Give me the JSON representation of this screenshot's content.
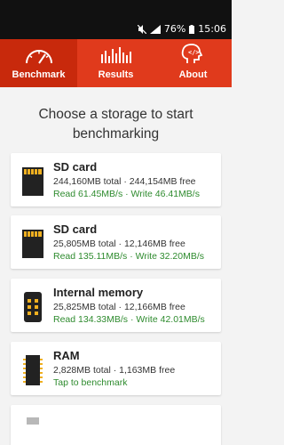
{
  "status": {
    "battery": "76%",
    "time": "15:06"
  },
  "tabs": [
    {
      "label": "Benchmark",
      "icon": "speedometer-icon"
    },
    {
      "label": "Results",
      "icon": "bar-graph-icon"
    },
    {
      "label": "About",
      "icon": "head-code-icon"
    }
  ],
  "heading": "Choose a storage to start benchmarking",
  "storages": [
    {
      "title": "SD card",
      "info": "244,160MB total · 244,154MB free",
      "speed": "Read 61.45MB/s · Write 46.41MB/s",
      "icon": "sd-card-icon"
    },
    {
      "title": "SD card",
      "info": "25,805MB total · 12,146MB free",
      "speed": "Read 135.11MB/s · Write 32.20MB/s",
      "icon": "sd-card-icon"
    },
    {
      "title": "Internal memory",
      "info": "25,825MB total · 12,166MB free",
      "speed": "Read 134.33MB/s · Write 42.01MB/s",
      "icon": "chip-icon"
    },
    {
      "title": "RAM",
      "info": "2,828MB total · 1,163MB free",
      "speed": "Tap to benchmark",
      "icon": "ram-icon"
    }
  ],
  "colors": {
    "accent": "#e03a1c",
    "accent_dark": "#c8290c",
    "speed": "#2e8b2e",
    "icon_gold": "#f0b020"
  }
}
